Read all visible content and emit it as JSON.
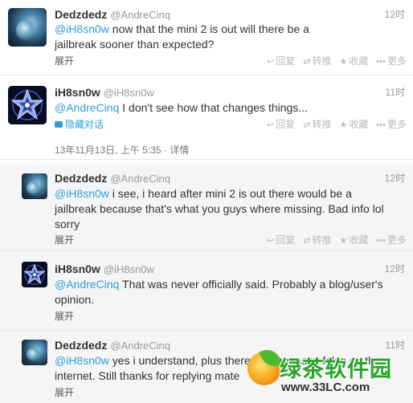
{
  "tweets": [
    {
      "fullname": "Dedzdedz",
      "username": "@AndreCinq",
      "time": "12时",
      "mention": "@iH8sn0w",
      "text": " now that the mini 2 is out will there be a jailbreak sooner than expected?",
      "expand": "展开",
      "avatar": "dedz-avatar"
    },
    {
      "fullname": "iH8sn0w",
      "username": "@iH8sn0w",
      "time": "11时",
      "mention": "@AndreCinq",
      "text": " I don't see how that changes things...",
      "hide_conversation": "隐藏对话",
      "detail_time": "13年11月13日, 上午 5:35",
      "detail_sep": "·",
      "detail_link": "详情",
      "avatar": "ih8-avatar"
    },
    {
      "fullname": "Dedzdedz",
      "username": "@AndreCinq",
      "time": "12时",
      "mention": "@iH8sn0w",
      "text": " i see, i heard after mini 2 is out there would be a jailbreak because that's what you guys where missing. Bad info lol sorry",
      "expand": "展开",
      "avatar": "dedz-avatar"
    },
    {
      "fullname": "iH8sn0w",
      "username": "@iH8sn0w",
      "time": "12时",
      "mention": "@AndreCinq",
      "text": " That was never officially said. Probably a blog/user's opinion.",
      "expand": "展开",
      "avatar": "ih8-avatar"
    },
    {
      "fullname": "Dedzdedz",
      "username": "@AndreCinq",
      "time": "11时",
      "mention": "@iH8sn0w",
      "text": " yes i understand, plus there are too many false on the internet. Still thanks for replying mate",
      "expand": "展开",
      "avatar": "dedz-avatar"
    }
  ],
  "actions": {
    "reply": "回复",
    "retweet": "转推",
    "favorite": "收藏",
    "more": "更多",
    "reply_icon": "reply-arrow-icon",
    "retweet_icon": "retweet-icon",
    "favorite_icon": "star-icon",
    "more_icon": "dots-icon"
  },
  "watermark": {
    "brand": "绿茶软件园",
    "url": "www.33LC.com"
  },
  "colors": {
    "link": "#2fa0d6",
    "muted": "#999999",
    "reply_bg": "#f5f5f5"
  }
}
